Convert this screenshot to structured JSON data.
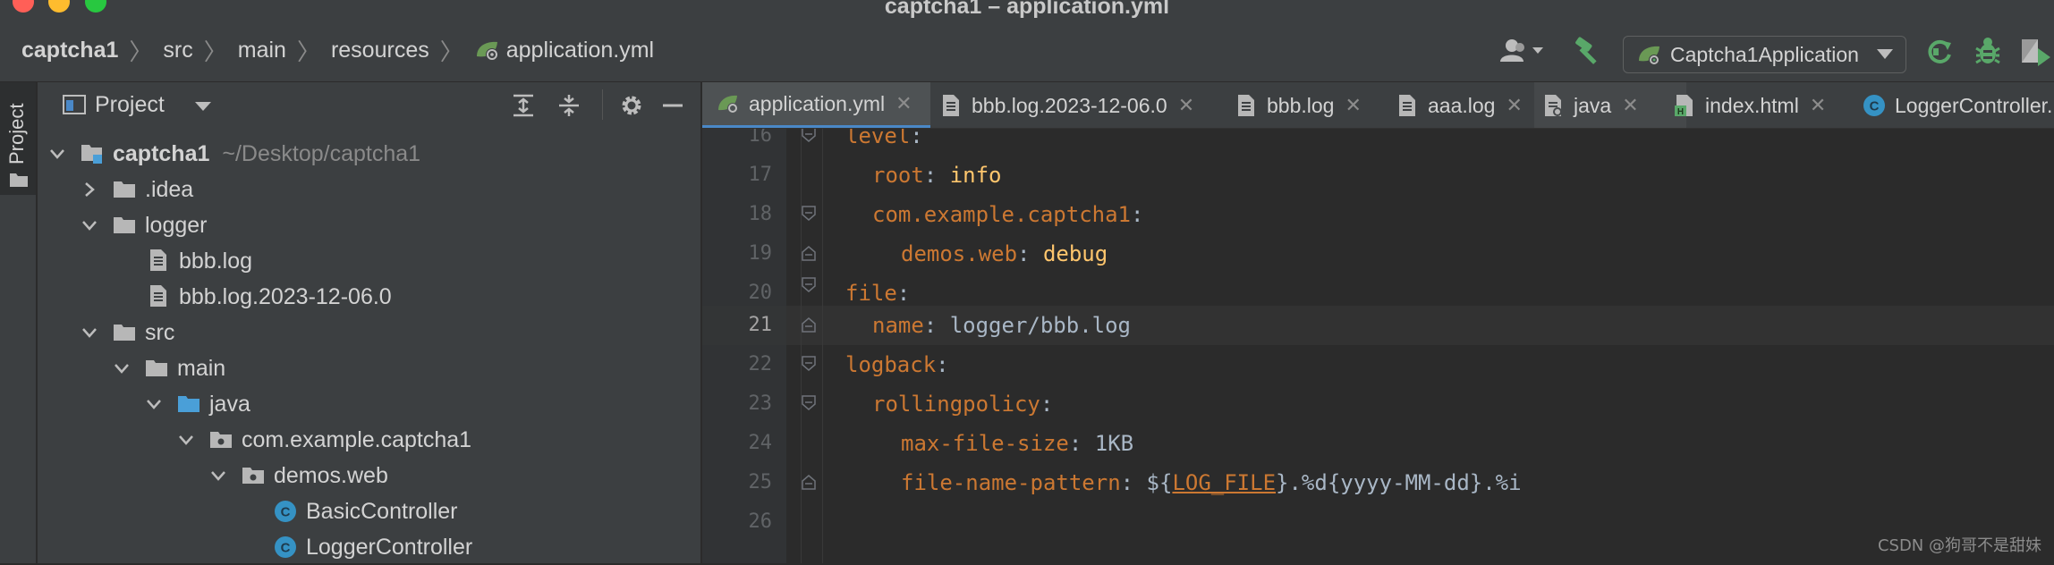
{
  "window": {
    "title": "captcha1 – application.yml"
  },
  "breadcrumb": {
    "items": [
      "captcha1",
      "src",
      "main",
      "resources",
      "application.yml"
    ]
  },
  "toolbar": {
    "run_config": "Captcha1Application"
  },
  "tool_strip": {
    "project_label": "Project"
  },
  "project_panel": {
    "title": "Project",
    "tree": [
      {
        "label": "captcha1",
        "hint": "~/Desktop/captcha1",
        "icon": "module-folder-icon",
        "expanded": true
      },
      {
        "label": ".idea",
        "icon": "folder-icon",
        "expanded": false
      },
      {
        "label": "logger",
        "icon": "folder-icon",
        "expanded": true
      },
      {
        "label": "bbb.log",
        "icon": "text-file-icon"
      },
      {
        "label": "bbb.log.2023-12-06.0",
        "icon": "text-file-icon"
      },
      {
        "label": "src",
        "icon": "folder-icon",
        "expanded": true
      },
      {
        "label": "main",
        "icon": "folder-icon",
        "expanded": true
      },
      {
        "label": "java",
        "icon": "source-root-folder-icon",
        "expanded": true
      },
      {
        "label": "com.example.captcha1",
        "icon": "package-icon",
        "expanded": true
      },
      {
        "label": "demos.web",
        "icon": "package-icon",
        "expanded": true
      },
      {
        "label": "BasicController",
        "icon": "class-icon"
      },
      {
        "label": "LoggerController",
        "icon": "class-icon"
      }
    ]
  },
  "tabs": [
    {
      "label": "application.yml",
      "icon": "yaml-spring-icon",
      "active": true
    },
    {
      "label": "bbb.log.2023-12-06.0",
      "icon": "text-file-icon"
    },
    {
      "label": "bbb.log",
      "icon": "text-file-icon"
    },
    {
      "label": "aaa.log",
      "icon": "text-file-icon"
    },
    {
      "label": "java",
      "icon": "text-file-icon"
    },
    {
      "label": "index.html",
      "icon": "html-file-icon"
    },
    {
      "label": "LoggerController.",
      "icon": "class-icon"
    }
  ],
  "editor": {
    "current_line": 21,
    "lines": [
      {
        "n": "16",
        "parts": [
          {
            "t": "level",
            "c": "k"
          },
          {
            "t": ":",
            "c": "p"
          }
        ]
      },
      {
        "n": "17",
        "parts": [
          {
            "t": "root",
            "c": "k"
          },
          {
            "t": ": ",
            "c": "p"
          },
          {
            "t": "info",
            "c": "v"
          }
        ]
      },
      {
        "n": "18",
        "parts": [
          {
            "t": "com.example.captcha1",
            "c": "k"
          },
          {
            "t": ":",
            "c": "p"
          }
        ]
      },
      {
        "n": "19",
        "parts": [
          {
            "t": "demos.web",
            "c": "k"
          },
          {
            "t": ": ",
            "c": "p"
          },
          {
            "t": "debug",
            "c": "v"
          }
        ]
      },
      {
        "n": "20",
        "parts": [
          {
            "t": "file",
            "c": "k"
          },
          {
            "t": ":",
            "c": "p"
          }
        ]
      },
      {
        "n": "21",
        "parts": [
          {
            "t": "name",
            "c": "k"
          },
          {
            "t": ": logger/bbb.log",
            "c": "p"
          }
        ]
      },
      {
        "n": "22",
        "parts": [
          {
            "t": "logback",
            "c": "k"
          },
          {
            "t": ":",
            "c": "p"
          }
        ]
      },
      {
        "n": "23",
        "parts": [
          {
            "t": "rollingpolicy",
            "c": "k"
          },
          {
            "t": ":",
            "c": "p"
          }
        ]
      },
      {
        "n": "24",
        "parts": [
          {
            "t": "max-file-size",
            "c": "k"
          },
          {
            "t": ": 1KB",
            "c": "p"
          }
        ]
      },
      {
        "n": "25",
        "parts": [
          {
            "t": "file-name-pattern",
            "c": "k"
          },
          {
            "t": ": ${",
            "c": "p"
          },
          {
            "t": "LOG_FILE",
            "c": "u"
          },
          {
            "t": "}.%d{yyyy-MM-dd}.%i",
            "c": "p"
          }
        ]
      },
      {
        "n": "26",
        "parts": []
      }
    ]
  },
  "watermark": "CSDN @狗哥不是甜妹",
  "colors": {
    "keyword": "#cc7832",
    "value": "#ffc66d",
    "plain": "#a9b7c6",
    "accent": "#4a88c7"
  }
}
